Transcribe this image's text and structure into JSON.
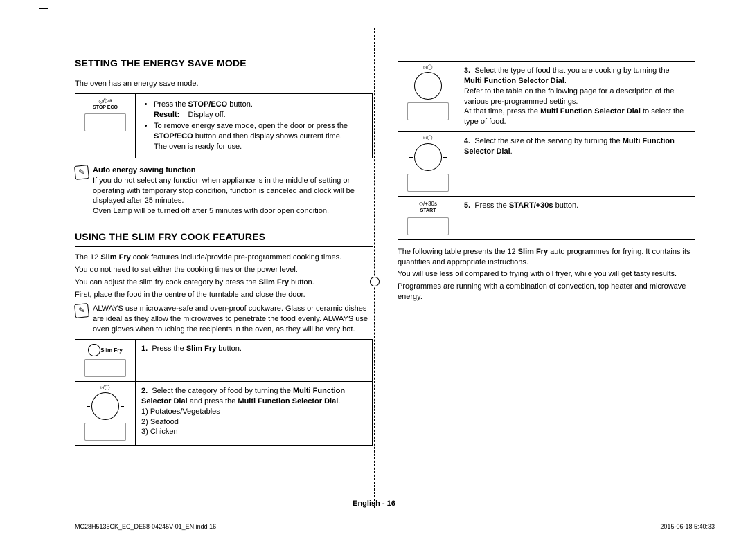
{
  "headings": {
    "h1": "SETTING THE ENERGY SAVE MODE",
    "h2": "USING THE SLIM FRY COOK FEATURES"
  },
  "energy": {
    "intro": "The oven has an energy save mode.",
    "icon_label": "STOP  ECO",
    "bul1_a": "Press the ",
    "bul1_b": "STOP/ECO",
    "bul1_c": " button.",
    "result_label": "Result:",
    "result_text": "Display off.",
    "bul2_a": "To remove energy save mode, open the door or press the ",
    "bul2_b": "STOP/ECO",
    "bul2_c": " button and then display shows current time.",
    "bul2_d": "The oven is ready for use.",
    "note_title": "Auto energy saving function",
    "note_p1": "If you do not select any function when appliance is in the middle of setting or operating with temporary stop condition, function is canceled and clock will be displayed after 25 minutes.",
    "note_p2": "Oven Lamp will be turned off after 5 minutes with door open condition."
  },
  "slimfry": {
    "p1_a": "The 12 ",
    "p1_b": "Slim Fry",
    "p1_c": " cook features include/provide pre-programmed cooking times.",
    "p2": "You do not need to set either the cooking times or the power level.",
    "p3_a": "You can adjust the slim fry cook category by press the ",
    "p3_b": "Slim Fry",
    "p3_c": " button.",
    "p4": "First, place the food in the centre of the turntable and close the door.",
    "note": "ALWAYS use microwave-safe and oven-proof cookware. Glass or ceramic dishes are ideal as they allow the microwaves to penetrate the food evenly. ALWAYS use oven gloves when touching the recipients in the oven, as they will be very hot.",
    "step1_icon": "Slim Fry",
    "step1_num": "1.",
    "step1_a": "Press the ",
    "step1_b": "Slim Fry",
    "step1_c": " button.",
    "step2_num": "2.",
    "step2_a": "Select the category of food by turning the ",
    "step2_b": "Multi Function Selector Dial",
    "step2_c": " and press the ",
    "step2_d": "Multi Function Selector Dial",
    "step2_e": ".",
    "step2_opt1": "1) Potatoes/Vegetables",
    "step2_opt2": "2) Seafood",
    "step2_opt3": "3) Chicken"
  },
  "right": {
    "step3_num": "3.",
    "step3_a": "Select the type of food that you are cooking by turning the ",
    "step3_b": "Multi Function Selector Dial",
    "step3_c": ".",
    "step3_p2": "Refer to the table on the following page for a description of the various pre-programmed settings.",
    "step3_p3_a": "At that time, press the ",
    "step3_p3_b": "Multi Function Selector Dial",
    "step3_p3_c": " to select the type of food.",
    "step4_num": "4.",
    "step4_a": "Select the size of the serving by turning the ",
    "step4_b": "Multi Function Selector Dial",
    "step4_c": ".",
    "step5_icon": "START",
    "step5_glyph": "◇/+30s",
    "step5_num": "5.",
    "step5_a": "Press the ",
    "step5_b": "START/+30s",
    "step5_c": " button.",
    "para1_a": "The following table presents the 12 ",
    "para1_b": "Slim Fry",
    "para1_c": " auto programmes for frying. It contains its quantities and appropriate instructions.",
    "para2": "You will use less oil compared to frying with oil fryer, while you will get tasty results.",
    "para3": "Programmes are running with a combination of convection, top heater and microwave energy."
  },
  "footer": {
    "center": "English - 16",
    "left": "MC28H5135CK_EC_DE68-04245V-01_EN.indd   16",
    "right": "2015-06-18      5:40:33"
  }
}
